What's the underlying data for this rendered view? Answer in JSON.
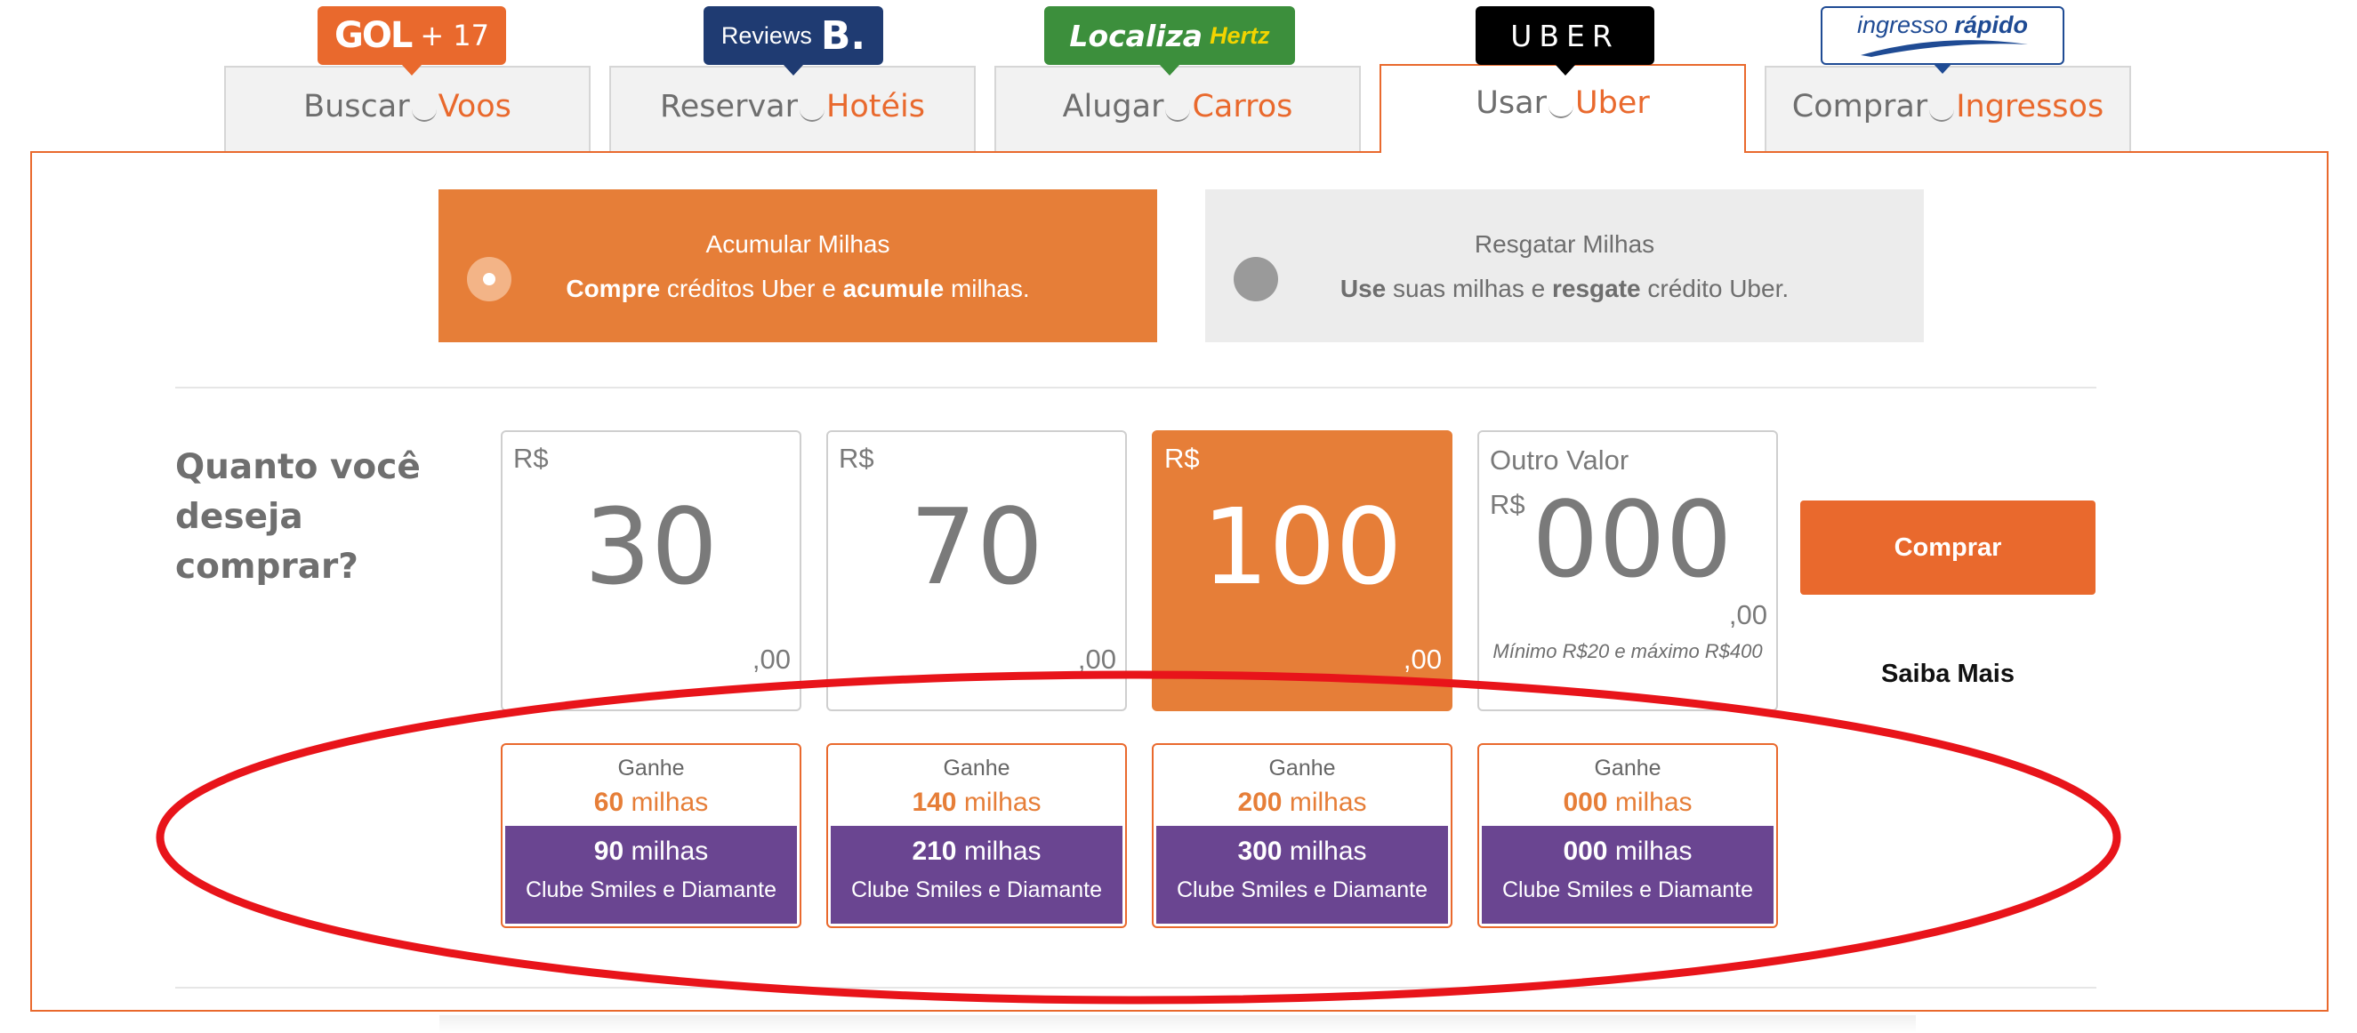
{
  "tabs": [
    {
      "prefix": "Buscar",
      "highlight": "Voos",
      "active": false,
      "logo": "GOL + 17",
      "logo_icon": "gol-logo"
    },
    {
      "prefix": "Reservar",
      "highlight": "Hotéis",
      "active": false,
      "logo_text": "Reviews",
      "logo_letter": "B.",
      "logo_icon": "booking-logo"
    },
    {
      "prefix": "Alugar",
      "highlight": "Carros",
      "active": false,
      "logo_text": "Localiza",
      "logo_sub": "Hertz",
      "logo_icon": "localiza-hertz-logo"
    },
    {
      "prefix": "Usar",
      "highlight": "Uber",
      "active": true,
      "logo_text": "UBER",
      "logo_icon": "uber-logo"
    },
    {
      "prefix": "Comprar",
      "highlight": "Ingressos",
      "active": false,
      "logo_text1": "ingresso",
      "logo_text2": "rápido",
      "logo_icon": "ingresso-rapido-logo"
    }
  ],
  "gol_logo": {
    "brand": "GOL",
    "plus": "+ 17"
  },
  "modes": {
    "accumulate": {
      "title": "Acumular Milhas",
      "b1": "Compre",
      "t1": " créditos Uber e ",
      "b2": "acumule",
      "t2": " milhas.",
      "selected": true
    },
    "redeem": {
      "title": "Resgatar Milhas",
      "b1": "Use",
      "t1": " suas milhas e ",
      "b2": "resgate",
      "t2": " crédito Uber.",
      "selected": false
    }
  },
  "question": "Quanto você deseja comprar?",
  "currency": "R$",
  "cents": ",00",
  "amounts": [
    {
      "value": "30",
      "selected": false
    },
    {
      "value": "70",
      "selected": false
    },
    {
      "value": "100",
      "selected": true
    }
  ],
  "custom_amount": {
    "label": "Outro Valor",
    "value": "000",
    "note": "Mínimo R$20 e máximo R$400"
  },
  "buy_button": "Comprar",
  "learn_more": "Saiba Mais",
  "earn_label": "Ganhe",
  "miles_unit": "milhas",
  "club_name": "Clube Smiles e Diamante",
  "earnings": [
    {
      "miles": "60",
      "club_miles": "90"
    },
    {
      "miles": "140",
      "club_miles": "210"
    },
    {
      "miles": "200",
      "club_miles": "300"
    },
    {
      "miles": "000",
      "club_miles": "000"
    }
  ],
  "colors": {
    "orange": "#e9692d",
    "orange_selected": "#e67e38",
    "purple": "#6a4591",
    "annotation_red": "#e8141a"
  }
}
